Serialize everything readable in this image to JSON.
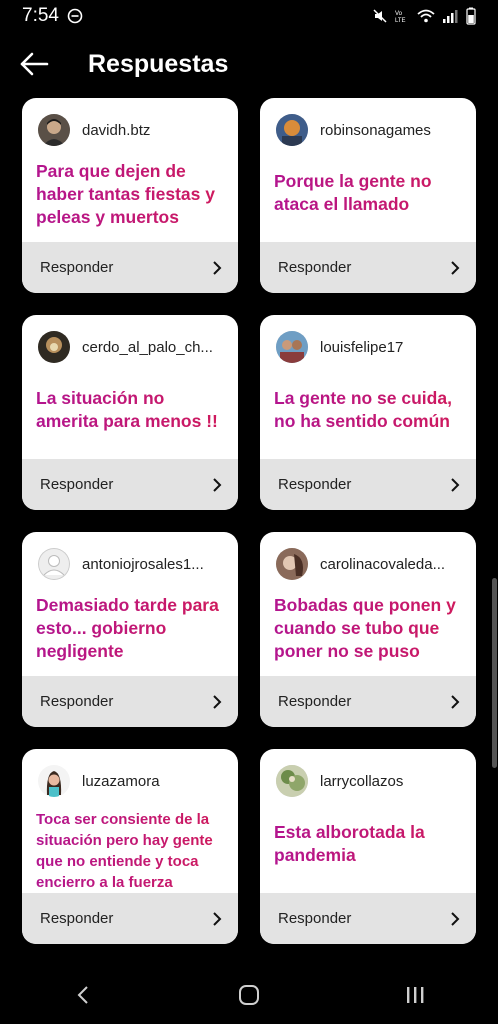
{
  "status": {
    "time": "7:54"
  },
  "header": {
    "title": "Respuestas"
  },
  "cards": [
    {
      "user": "davidh.btz",
      "text": "Para que dejen de haber tantas fiestas y peleas y muertos",
      "reply": "Responder"
    },
    {
      "user": "robinsonagames",
      "text": "Porque la gente no ataca el llamado",
      "reply": "Responder"
    },
    {
      "user": "cerdo_al_palo_ch...",
      "text": "La situación no amerita para menos !!",
      "reply": "Responder"
    },
    {
      "user": "louisfelipe17",
      "text": "La gente no se cuida, no ha sentido común",
      "reply": "Responder"
    },
    {
      "user": "antoniojrosales1...",
      "text": "Demasiado tarde para esto... gobierno negligente",
      "reply": "Responder"
    },
    {
      "user": "carolinacovaleda...",
      "text": "Bobadas que ponen y cuando se tubo que poner no se puso",
      "reply": "Responder"
    },
    {
      "user": "luzazamora",
      "text": "Toca ser consiente de la situación pero hay gente que no entiende y toca encierro a la fuerza",
      "reply": "Responder"
    },
    {
      "user": "larrycollazos",
      "text": "Esta alborotada la pandemia",
      "reply": "Responder"
    }
  ],
  "colors": {
    "background": "#000000",
    "card": "#ffffff",
    "reply_bar": "#e3e3e3",
    "accent_start": "#b3158f",
    "accent_end": "#d01a5a"
  },
  "icons": {
    "back": "arrow-left-icon",
    "reply": "chevron-right-icon",
    "nav": [
      "nav-back-icon",
      "nav-home-icon",
      "nav-recents-icon"
    ]
  }
}
